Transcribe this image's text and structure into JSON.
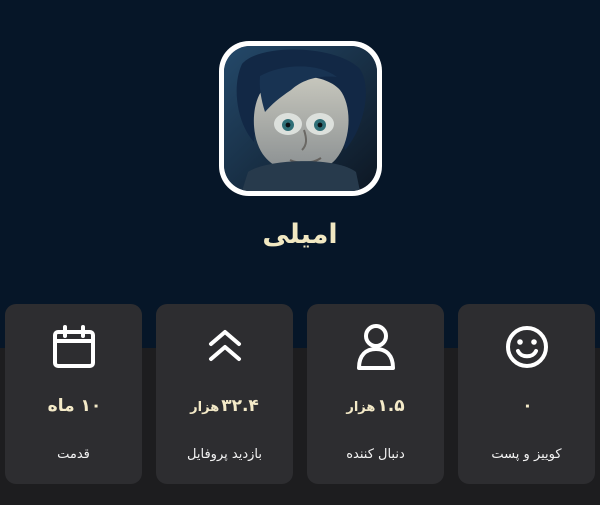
{
  "profile": {
    "name": "امیلی"
  },
  "stats": [
    {
      "value": "۱۰ ماه",
      "unit": "",
      "label": "قدمت",
      "icon": "calendar-icon"
    },
    {
      "value": "۳۲.۴",
      "unit": "هزار",
      "label": "بازدید پروفایل",
      "icon": "double-chevron-up-icon"
    },
    {
      "value": "۱.۵",
      "unit": "هزار",
      "label": "دنبال کننده",
      "icon": "user-icon"
    },
    {
      "value": "۰",
      "unit": "",
      "label": "کوییز و پست",
      "icon": "smiley-icon"
    }
  ],
  "colors": {
    "hero_background": "#061628",
    "card_background": "#2d2d30",
    "value_text": "#f4eac8"
  }
}
